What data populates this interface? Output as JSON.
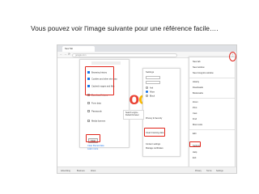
{
  "caption": "Vous pouvez voir l'image suivante pour une référence facile….",
  "colors": {
    "highlight": "#e0241b",
    "accent": "#1a73e8",
    "logo_letters": [
      "#4285f4",
      "#ea4335",
      "#fbbc05"
    ]
  },
  "browser": {
    "tab_title": "New Tab",
    "address": "google.com",
    "nav_icons": [
      "back-arrow-icon",
      "forward-arrow-icon",
      "reload-icon"
    ],
    "menu_icon": "three-dots-icon"
  },
  "logo": {
    "letters": [
      "G",
      "o",
      "o"
    ]
  },
  "clear_dialog": {
    "rows": [
      {
        "label": "Browsing history",
        "checked": true
      },
      {
        "label": "Cookies and other site data",
        "checked": true
      },
      {
        "label": "Cached images and files",
        "checked": true
      },
      {
        "label": "Download history",
        "checked": false
      },
      {
        "label": "Form data",
        "checked": false
      },
      {
        "label": "Passwords",
        "checked": false
      },
      {
        "label": "Media licenses",
        "checked": false
      }
    ],
    "button_label": "Clear",
    "links": [
      "Clear filtered data",
      "Learn more"
    ]
  },
  "settings_panel": {
    "title": "Settings",
    "rows": [
      "Privacy & Security",
      "Clear browsing data",
      "Content settings",
      "Manage certificates"
    ],
    "options": [
      {
        "label": "Ask",
        "on": false
      },
      {
        "label": "Allow",
        "on": true
      },
      {
        "label": "Block",
        "on": false
      }
    ],
    "highlight_label": "Clear browsing data"
  },
  "sub_panel": {
    "rows": [
      "Search engine",
      "Default browser"
    ]
  },
  "menu": {
    "items": [
      "New tab",
      "New window",
      "New incognito window",
      "History",
      "Downloads",
      "Bookmarks",
      "Zoom",
      "Print",
      "Cast",
      "Find",
      "More tools",
      "Edit",
      "Settings",
      "Help",
      "Exit"
    ],
    "highlighted_item": "Settings"
  },
  "bottom_bar": {
    "items": [
      "Advertising",
      "Business",
      "About",
      "Privacy",
      "Terms",
      "Settings"
    ]
  }
}
